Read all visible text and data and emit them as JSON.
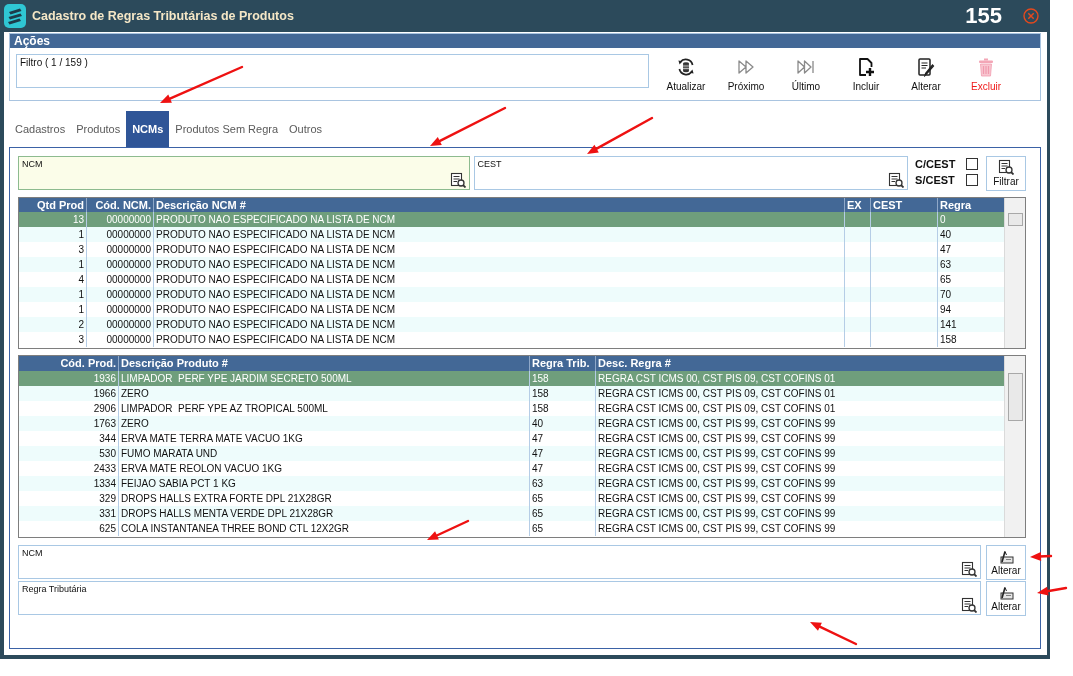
{
  "window": {
    "title": "Cadastro de Regras Tributárias de Produtos",
    "counter": "155"
  },
  "actions": {
    "title": "Ações",
    "filter": {
      "label": "Filtro ( 1 / 159 )"
    },
    "buttons": [
      {
        "label": "Atualizar",
        "kind": "refresh"
      },
      {
        "label": "Próximo",
        "kind": "next"
      },
      {
        "label": "Último",
        "kind": "last"
      },
      {
        "label": "Incluir",
        "kind": "add"
      },
      {
        "label": "Alterar",
        "kind": "edit"
      },
      {
        "label": "Excluir",
        "kind": "delete"
      }
    ]
  },
  "tabs": [
    {
      "label": "Cadastros",
      "selected": false
    },
    {
      "label": "Produtos",
      "selected": false
    },
    {
      "label": "NCMs",
      "selected": true
    },
    {
      "label": "Produtos Sem Regra",
      "selected": false
    },
    {
      "label": "Outros",
      "selected": false
    }
  ],
  "ncm_search": {
    "ncm_field": {
      "label": "NCM"
    },
    "cest_field": {
      "label": "CEST"
    },
    "checkboxes": [
      {
        "label": "C/CEST",
        "checked": false
      },
      {
        "label": "S/CEST",
        "checked": false
      }
    ],
    "filter_button": {
      "label": "Filtrar"
    }
  },
  "ncm_table": {
    "columns": [
      "Qtd Prod",
      "Cód. NCM.",
      "Descrição NCM #",
      "EX",
      "CEST",
      "Regra"
    ],
    "rows": [
      {
        "qtd_prod": "13",
        "cod_ncm": "00000000",
        "descricao": "PRODUTO NAO ESPECIFICADO NA LISTA DE NCM",
        "regra": "0",
        "selected": true
      },
      {
        "qtd_prod": "1",
        "cod_ncm": "00000000",
        "descricao": "PRODUTO NAO ESPECIFICADO NA LISTA DE NCM",
        "regra": "40",
        "selected": false
      },
      {
        "qtd_prod": "3",
        "cod_ncm": "00000000",
        "descricao": "PRODUTO NAO ESPECIFICADO NA LISTA DE NCM",
        "regra": "47",
        "selected": false
      },
      {
        "qtd_prod": "1",
        "cod_ncm": "00000000",
        "descricao": "PRODUTO NAO ESPECIFICADO NA LISTA DE NCM",
        "regra": "63",
        "selected": false
      },
      {
        "qtd_prod": "4",
        "cod_ncm": "00000000",
        "descricao": "PRODUTO NAO ESPECIFICADO NA LISTA DE NCM",
        "regra": "65",
        "selected": false
      },
      {
        "qtd_prod": "1",
        "cod_ncm": "00000000",
        "descricao": "PRODUTO NAO ESPECIFICADO NA LISTA DE NCM",
        "regra": "70",
        "selected": false
      },
      {
        "qtd_prod": "1",
        "cod_ncm": "00000000",
        "descricao": "PRODUTO NAO ESPECIFICADO NA LISTA DE NCM",
        "regra": "94",
        "selected": false
      },
      {
        "qtd_prod": "2",
        "cod_ncm": "00000000",
        "descricao": "PRODUTO NAO ESPECIFICADO NA LISTA DE NCM",
        "regra": "141",
        "selected": false
      },
      {
        "qtd_prod": "3",
        "cod_ncm": "00000000",
        "descricao": "PRODUTO NAO ESPECIFICADO NA LISTA DE NCM",
        "regra": "158",
        "selected": false
      }
    ]
  },
  "product_table": {
    "columns": [
      "Cód. Prod.",
      "Descrição Produto #",
      "Regra Trib.",
      "Desc. Regra #"
    ],
    "rows": [
      {
        "cod_prod": "1936",
        "descricao": "LIMPADOR  PERF YPE JARDIM SECRETO 500ML",
        "regra_trib": "158",
        "desc_regra": "REGRA CST ICMS 00, CST PIS 09, CST COFINS 01",
        "selected": true
      },
      {
        "cod_prod": "1966",
        "descricao": "ZERO",
        "regra_trib": "158",
        "desc_regra": "REGRA CST ICMS 00, CST PIS 09, CST COFINS 01",
        "selected": false
      },
      {
        "cod_prod": "2906",
        "descricao": "LIMPADOR  PERF YPE AZ TROPICAL 500ML",
        "regra_trib": "158",
        "desc_regra": "REGRA CST ICMS 00, CST PIS 09, CST COFINS 01",
        "selected": false
      },
      {
        "cod_prod": "1763",
        "descricao": "ZERO",
        "regra_trib": "40",
        "desc_regra": "REGRA CST ICMS 00, CST PIS 99, CST COFINS 99",
        "selected": false
      },
      {
        "cod_prod": "344",
        "descricao": "ERVA MATE TERRA MATE VACUO 1KG",
        "regra_trib": "47",
        "desc_regra": "REGRA CST ICMS 00, CST PIS 99, CST COFINS 99",
        "selected": false
      },
      {
        "cod_prod": "530",
        "descricao": "FUMO MARATA UND",
        "regra_trib": "47",
        "desc_regra": "REGRA CST ICMS 00, CST PIS 99, CST COFINS 99",
        "selected": false
      },
      {
        "cod_prod": "2433",
        "descricao": "ERVA MATE REOLON VACUO 1KG",
        "regra_trib": "47",
        "desc_regra": "REGRA CST ICMS 00, CST PIS 99, CST COFINS 99",
        "selected": false
      },
      {
        "cod_prod": "1334",
        "descricao": "FEIJAO SABIA PCT 1 KG",
        "regra_trib": "63",
        "desc_regra": "REGRA CST ICMS 00, CST PIS 99, CST COFINS 99",
        "selected": false
      },
      {
        "cod_prod": "329",
        "descricao": "DROPS HALLS EXTRA FORTE DPL 21X28GR",
        "regra_trib": "65",
        "desc_regra": "REGRA CST ICMS 00, CST PIS 99, CST COFINS 99",
        "selected": false
      },
      {
        "cod_prod": "331",
        "descricao": "DROPS HALLS MENTA VERDE DPL 21X28GR",
        "regra_trib": "65",
        "desc_regra": "REGRA CST ICMS 00, CST PIS 99, CST COFINS 99",
        "selected": false
      },
      {
        "cod_prod": "625",
        "descricao": "COLA INSTANTANEA THREE BOND CTL 12X2GR",
        "regra_trib": "65",
        "desc_regra": "REGRA CST ICMS 00, CST PIS 99, CST COFINS 99",
        "selected": false
      }
    ]
  },
  "edit_fields": [
    {
      "label": "NCM",
      "button": "Alterar"
    },
    {
      "label": "Regra Tributária",
      "button": "Alterar"
    }
  ]
}
